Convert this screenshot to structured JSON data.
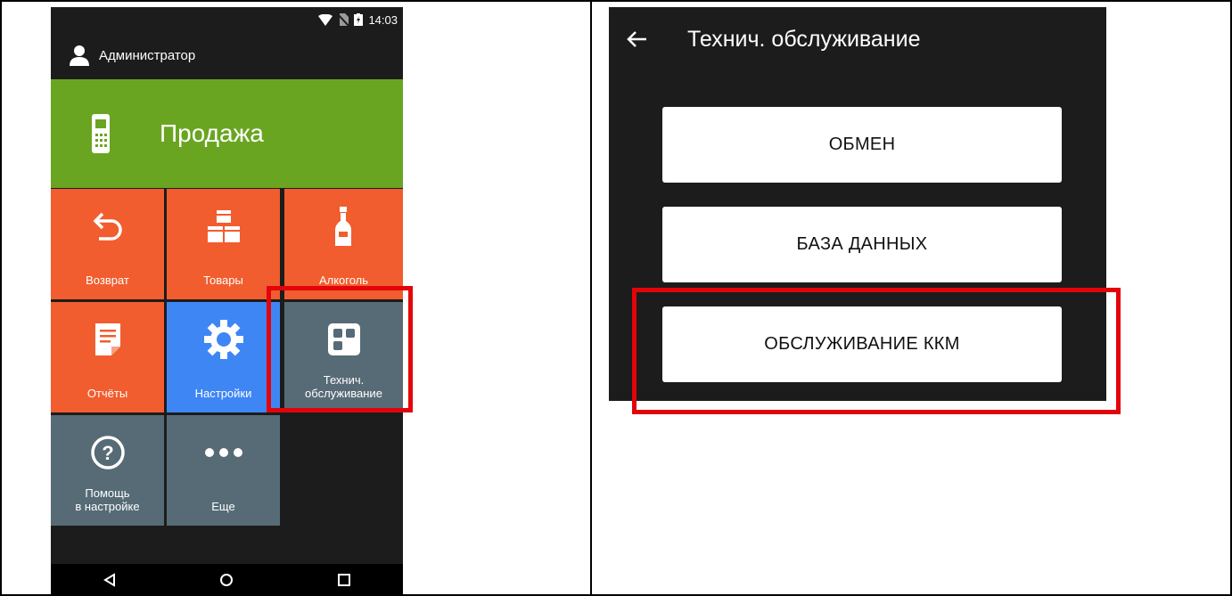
{
  "left_screen": {
    "status_bar": {
      "time": "14:03",
      "icons": [
        "wifi-icon",
        "no-sim-icon",
        "battery-icon"
      ]
    },
    "header": {
      "user_name": "Администратор",
      "icon": "user-icon"
    },
    "sale": {
      "label": "Продажа",
      "icon": "pos-terminal-icon",
      "color": "#6aa521"
    },
    "tiles": [
      {
        "label": "Возврат",
        "icon": "undo-arrow-icon",
        "color": "#f15d2e"
      },
      {
        "label": "Товары",
        "icon": "boxes-icon",
        "color": "#f15d2e"
      },
      {
        "label": "Алкоголь",
        "icon": "bottle-icon",
        "color": "#f15d2e"
      },
      {
        "label": "Отчёты",
        "icon": "report-icon",
        "color": "#f15d2e"
      },
      {
        "label": "Настройки",
        "icon": "gear-icon",
        "color": "#3f86f5"
      },
      {
        "label": "Технич.\nобслуживание",
        "icon": "service-grid-icon",
        "color": "#566b76"
      },
      {
        "label": "Помощь\nв настройке",
        "icon": "help-icon",
        "color": "#566b76"
      },
      {
        "label": "Еще",
        "icon": "more-dots-icon",
        "color": "#566b76"
      }
    ],
    "nav_bar": [
      "back-triangle-icon",
      "home-circle-icon",
      "recents-square-icon"
    ]
  },
  "right_screen": {
    "title": "Технич. обслуживание",
    "back_icon": "arrow-left-icon",
    "buttons": [
      {
        "label": "ОБМЕН"
      },
      {
        "label": "БАЗА ДАННЫХ"
      },
      {
        "label": "ОБСЛУЖИВАНИЕ ККМ"
      }
    ]
  },
  "highlight_color": "#e3040a"
}
